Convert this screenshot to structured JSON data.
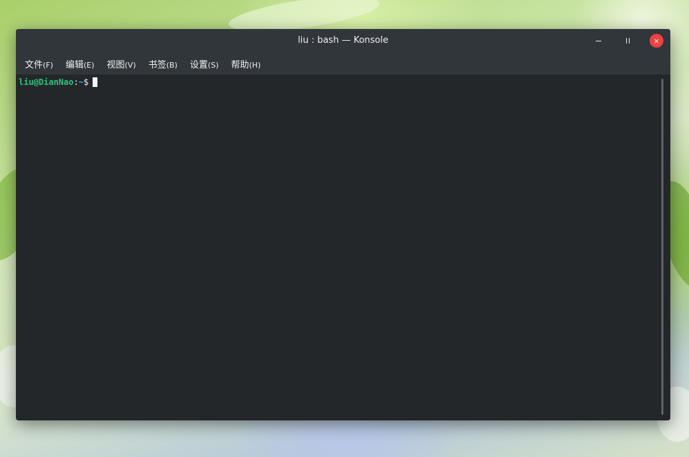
{
  "window": {
    "title": "liu : bash — Konsole",
    "close_glyph": "×"
  },
  "menu": {
    "items": [
      {
        "label": "文件",
        "accel": "(F)"
      },
      {
        "label": "编辑",
        "accel": "(E)"
      },
      {
        "label": "视图",
        "accel": "(V)"
      },
      {
        "label": "书签",
        "accel": "(B)"
      },
      {
        "label": "设置",
        "accel": "(S)"
      },
      {
        "label": "帮助",
        "accel": "(H)"
      }
    ]
  },
  "terminal": {
    "user_host": "liu@DianNao",
    "separator": ":",
    "path": "~",
    "prompt_char": "$"
  },
  "colors": {
    "titlebar": "#31363b",
    "terminal_bg": "#232729",
    "prompt_user": "#2ec27e",
    "prompt_path": "#3daee9",
    "close_button": "#ed4242"
  }
}
